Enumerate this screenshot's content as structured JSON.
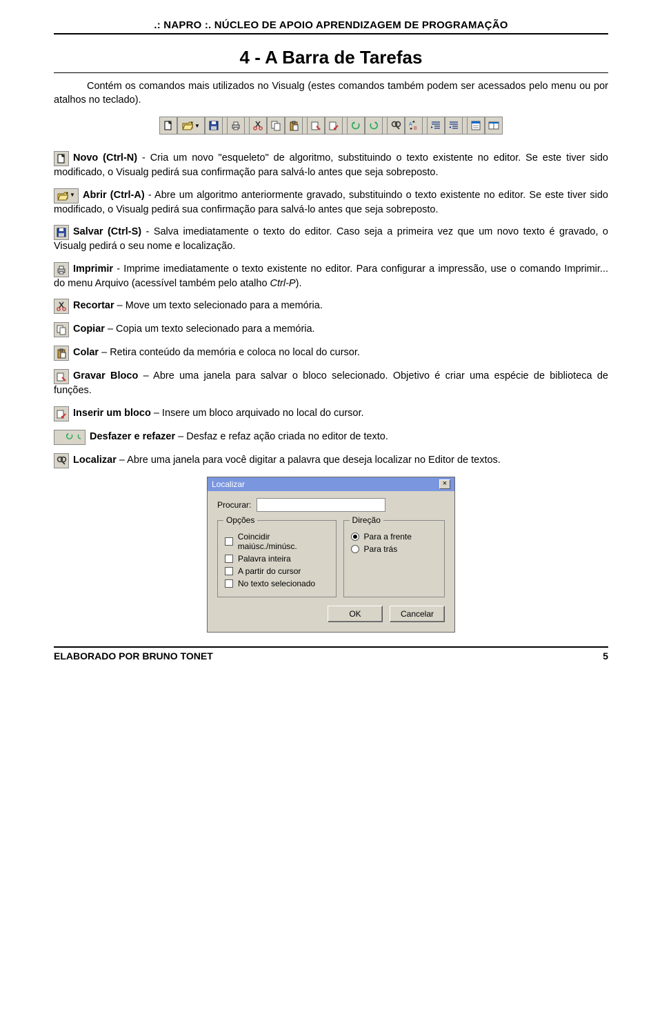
{
  "header": ".: NAPRO :. NÚCLEO DE APOIO APRENDIZAGEM DE PROGRAMAÇÃO",
  "title": "4 -   A Barra de Tarefas",
  "intro": "Contém os comandos mais utilizados no Visualg (estes comandos também podem ser acessados pelo menu ou por atalhos no teclado).",
  "toolbar_icons": [
    {
      "name": "new-icon"
    },
    {
      "name": "open-icon"
    },
    {
      "name": "save-icon"
    },
    {
      "name": "sep"
    },
    {
      "name": "print-icon"
    },
    {
      "name": "sep"
    },
    {
      "name": "cut-icon"
    },
    {
      "name": "copy-icon"
    },
    {
      "name": "paste-icon"
    },
    {
      "name": "sep"
    },
    {
      "name": "save-block-icon"
    },
    {
      "name": "insert-block-icon"
    },
    {
      "name": "sep"
    },
    {
      "name": "undo-icon"
    },
    {
      "name": "redo-icon"
    },
    {
      "name": "sep"
    },
    {
      "name": "find-icon"
    },
    {
      "name": "replace-icon"
    },
    {
      "name": "sep"
    },
    {
      "name": "indent-icon"
    },
    {
      "name": "outdent-icon"
    },
    {
      "name": "sep"
    },
    {
      "name": "show1-icon"
    },
    {
      "name": "show2-icon"
    }
  ],
  "entries": [
    {
      "icon": "new-icon",
      "label": "Novo (Ctrl-N)",
      "sep": " - ",
      "text": "Cria um novo \"esqueleto\" de algoritmo, substituindo o texto existente no editor. Se este tiver sido modificado, o Visualg pedirá sua confirmação para salvá-lo antes que seja sobreposto."
    },
    {
      "icon": "open-icon",
      "wide": true,
      "label": "Abrir (Ctrl-A)",
      "sep": " - ",
      "text": "Abre um algoritmo anteriormente gravado, substituindo o texto existente no editor. Se este tiver sido modificado, o Visualg pedirá sua confirmação para salvá-lo antes que seja sobreposto."
    },
    {
      "icon": "save-icon",
      "label": "Salvar (Ctrl-S)",
      "sep": " - ",
      "text": "Salva imediatamente o texto do editor. Caso seja a primeira vez que um novo texto é gravado, o Visualg pedirá o seu nome e localização."
    },
    {
      "icon": "print-icon",
      "label": "Imprimir",
      "sep": " - ",
      "text": "Imprime imediatamente o texto existente no editor. Para configurar a impressão, use o comando Imprimir... do menu Arquivo (acessível também pelo atalho ",
      "ital": "Ctrl-P",
      "after": ")."
    },
    {
      "icon": "cut-icon",
      "label": "Recortar",
      "sep": " – ",
      "text": "Move um texto selecionado para a memória."
    },
    {
      "icon": "copy-icon",
      "label": "Copiar",
      "sep": " – ",
      "text": "Copia um texto selecionado para a memória."
    },
    {
      "icon": "paste-icon",
      "label": "Colar",
      "sep": " – ",
      "text": "Retira conteúdo da memória e coloca no local do cursor."
    },
    {
      "icon": "save-block-icon",
      "label": "Gravar Bloco",
      "sep": " – ",
      "text": "Abre uma janela para salvar o bloco selecionado. Objetivo é criar uma espécie de biblioteca de funções."
    },
    {
      "icon": "insert-block-icon",
      "label": "Inserir um bloco",
      "sep": " – ",
      "text": "Insere um bloco arquivado no local do cursor."
    },
    {
      "icon": "undo-redo-icon",
      "pair": true,
      "label": "Desfazer e refazer",
      "sep": " – ",
      "text": "Desfaz e refaz ação criada no editor de texto."
    },
    {
      "icon": "find-icon",
      "label": "Localizar",
      "sep": " – ",
      "text": "Abre uma janela para você digitar a palavra que deseja localizar no Editor de textos."
    }
  ],
  "dialog": {
    "title": "Localizar",
    "search_label": "Procurar:",
    "search_value": "",
    "options_legend": "Opções",
    "options": [
      "Coincidir maiúsc./minúsc.",
      "Palavra inteira",
      "A partir do cursor",
      "No texto selecionado"
    ],
    "direction_legend": "Direção",
    "direction": [
      {
        "label": "Para a frente",
        "selected": true
      },
      {
        "label": "Para trás",
        "selected": false
      }
    ],
    "ok": "OK",
    "cancel": "Cancelar"
  },
  "footer": {
    "left": "ELABORADO POR BRUNO TONET",
    "right": "5"
  }
}
